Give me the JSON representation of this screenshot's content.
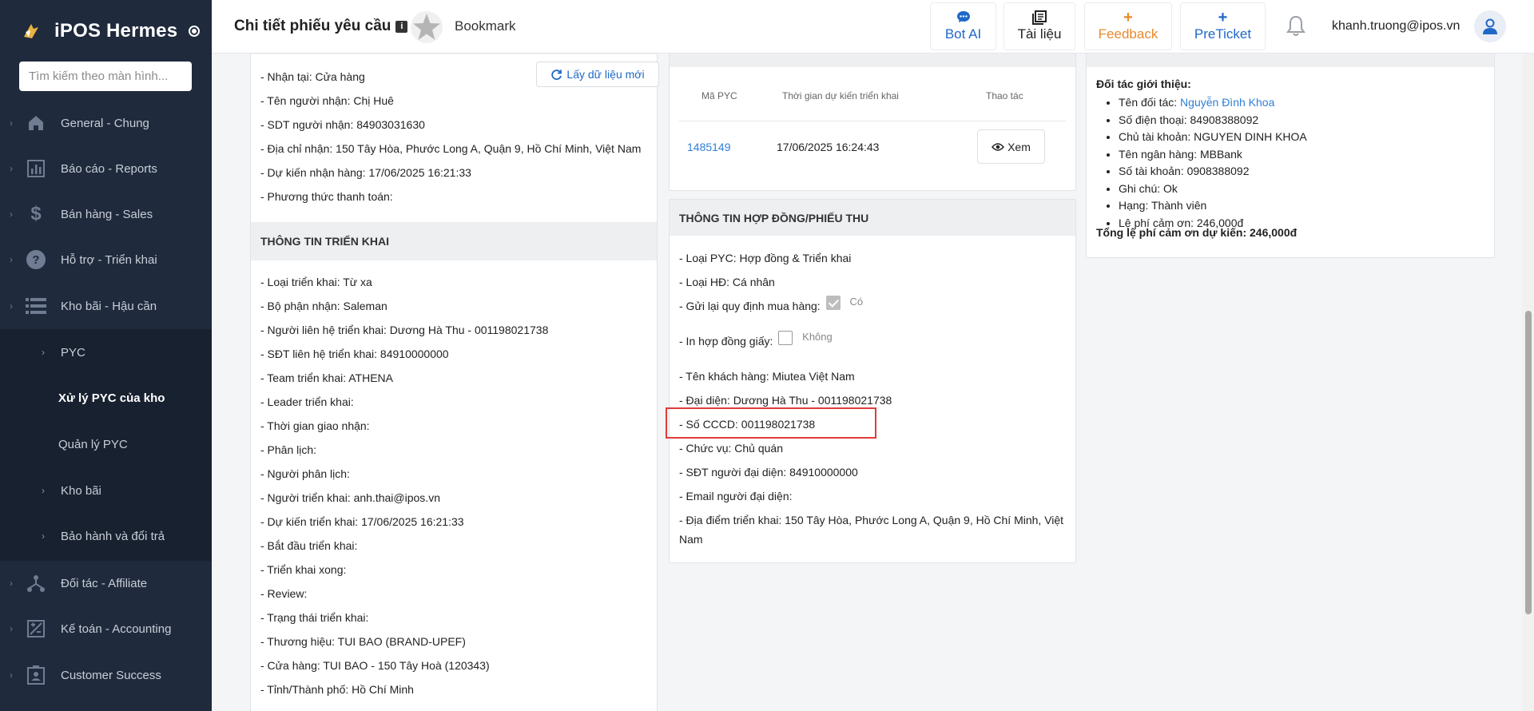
{
  "app": {
    "name": "iPOS Hermes"
  },
  "sidebar": {
    "search_placeholder": "Tìm kiếm theo màn hình...",
    "items": [
      {
        "label": "General - Chung",
        "icon": "home-icon"
      },
      {
        "label": "Báo cáo - Reports",
        "icon": "chart-icon"
      },
      {
        "label": "Bán hàng - Sales",
        "icon": "dollar-icon"
      },
      {
        "label": "Hỗ trợ - Triển khai",
        "icon": "help-icon"
      },
      {
        "label": "Kho bãi - Hậu cần",
        "icon": "list-icon"
      },
      {
        "label": "Đối tác - Affiliate",
        "icon": "network-icon"
      },
      {
        "label": "Kế toán - Accounting",
        "icon": "accounting-icon"
      },
      {
        "label": "Customer Success",
        "icon": "id-card-icon"
      }
    ],
    "sub_items": [
      {
        "label": "PYC",
        "has_chevron": true
      },
      {
        "label": "Xử lý PYC của kho",
        "has_chevron": false,
        "active": true
      },
      {
        "label": "Quản lý PYC",
        "has_chevron": false
      },
      {
        "label": "Kho bãi",
        "has_chevron": true
      },
      {
        "label": "Bảo hành và đổi trả",
        "has_chevron": true
      }
    ]
  },
  "topbar": {
    "title": "Chi tiết phiếu yêu cầu",
    "bookmark_label": "Bookmark",
    "buttons": {
      "bot_ai": "Bot AI",
      "docs": "Tài liệu",
      "feedback": "Feedback",
      "preticket": "PreTicket"
    },
    "user_email": "khanh.truong@ipos.vn"
  },
  "colors": {
    "accent": "#1f68c7",
    "feedback": "#e8892c",
    "sidebar_bg": "#1f2a3c",
    "highlight": "#e03c3c"
  },
  "receive_info": {
    "refresh_button": "Lấy dữ liệu mới",
    "lines": [
      "- Nhận tại: Cửa hàng",
      "- Tên người nhận: Chị Huê",
      "- SDT người nhận: 84903031630",
      "- Địa chỉ nhận: 150 Tây Hòa, Phước Long A, Quận 9, Hồ Chí Minh, Việt Nam",
      "- Dự kiến nhận hàng: 17/06/2025 16:21:33",
      "- Phương thức thanh toán:"
    ]
  },
  "deploy_info": {
    "title": "THÔNG TIN TRIỂN KHAI",
    "lines": [
      "- Loại triển khai: Từ xa",
      "- Bộ phận nhận: Saleman",
      "- Người liên hệ triển khai: Dương Hà Thu - 001198021738",
      "- SĐT liên hệ triển khai: 84910000000",
      "- Team triển khai: ATHENA",
      "- Leader triển khai:",
      "- Thời gian giao nhận:",
      "- Phân lịch:",
      "- Người phân lịch:",
      "- Người triển khai: anh.thai@ipos.vn",
      "- Dự kiến triển khai: 17/06/2025 16:21:33",
      "- Bắt đầu triển khai:",
      "- Triển khai xong:",
      "- Review:",
      "- Trạng thái triển khai:",
      "- Thương hiệu: TUI BAO (BRAND-UPEF)",
      "- Cửa hàng: TUI BAO - 150 Tây Hoà (120343)",
      "- Tỉnh/Thành phố: Hồ Chí Minh"
    ]
  },
  "pyc_table": {
    "headers": [
      "Mã PYC",
      "Thời gian dự kiến triển khai",
      "Thao tác"
    ],
    "rows": [
      {
        "code": "1485149",
        "time": "17/06/2025 16:24:43",
        "action": "Xem"
      }
    ]
  },
  "contract_info": {
    "title": "THÔNG TIN HỢP ĐỒNG/PHIẾU THU",
    "type_line": "- Loại PYC: Hợp đồng & Triển khai",
    "contract_type_line": "- Loại HĐ: Cá nhân",
    "resend_label": "- Gửi lại quy định mua hàng:",
    "resend_value": "Có",
    "resend_checked": true,
    "paper_label": "- In hợp đồng giấy:",
    "paper_value": "Không",
    "paper_checked": false,
    "customer_line": "- Tên khách hàng: Miutea Việt Nam",
    "rep_line": "- Đại diện: Dương Hà Thu - 001198021738",
    "cccd_line": "- Số CCCD: 001198021738",
    "position_line": "- Chức vụ: Chủ quán",
    "rep_phone_line": "- SĐT người đại diện: 84910000000",
    "rep_email_line": "- Email người đại diện:",
    "location_line1": "- Địa điểm triển khai: 150 Tây Hòa, Phước Long A, Quận 9, Hồ Chí Minh, Việt",
    "location_line2": "Nam"
  },
  "partner_info": {
    "title": "Đối tác giới thiệu:",
    "partner_label": "Tên đối tác: ",
    "partner_name": "Nguyễn Đình Khoa",
    "items": [
      "Số điện thoại: 84908388092",
      "Chủ tài khoản: NGUYEN DINH KHOA",
      "Tên ngân hàng: MBBank",
      "Số tài khoản: 0908388092",
      "Ghi chú: Ok",
      "Hạng: Thành viên",
      "Lệ phí cảm ơn: 246,000đ"
    ],
    "total": "Tổng lệ phí cảm ơn dự kiến: 246,000đ"
  }
}
